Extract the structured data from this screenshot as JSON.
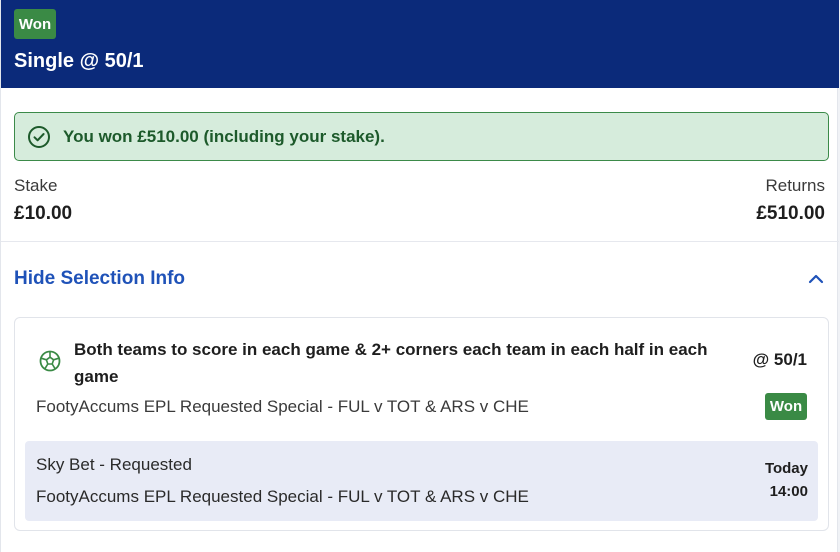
{
  "header": {
    "status_badge": "Won",
    "title": "Single @ 50/1",
    "background_color": "#0b2a7a"
  },
  "result_banner": {
    "icon": "check-circle-icon",
    "message": "You won £510.00 (including your stake).",
    "color": "#3b8a49"
  },
  "summary": {
    "stake_label": "Stake",
    "stake_value": "£10.00",
    "returns_label": "Returns",
    "returns_value": "£510.00"
  },
  "selection_toggle": {
    "label": "Hide Selection Info",
    "icon": "chevron-up-icon",
    "color": "#1f52b8"
  },
  "selection": {
    "sport_icon": "football-icon",
    "market": "Both teams to score in each game & 2+ corners each team in each half in each game",
    "odds": "@ 50/1",
    "event": "FootyAccums EPL Requested Special - FUL v TOT & ARS v CHE",
    "status_badge": "Won",
    "details": {
      "source": "Sky Bet - Requested",
      "event": "FootyAccums EPL Requested Special - FUL v TOT & ARS v CHE",
      "date": "Today",
      "time": "14:00"
    }
  }
}
